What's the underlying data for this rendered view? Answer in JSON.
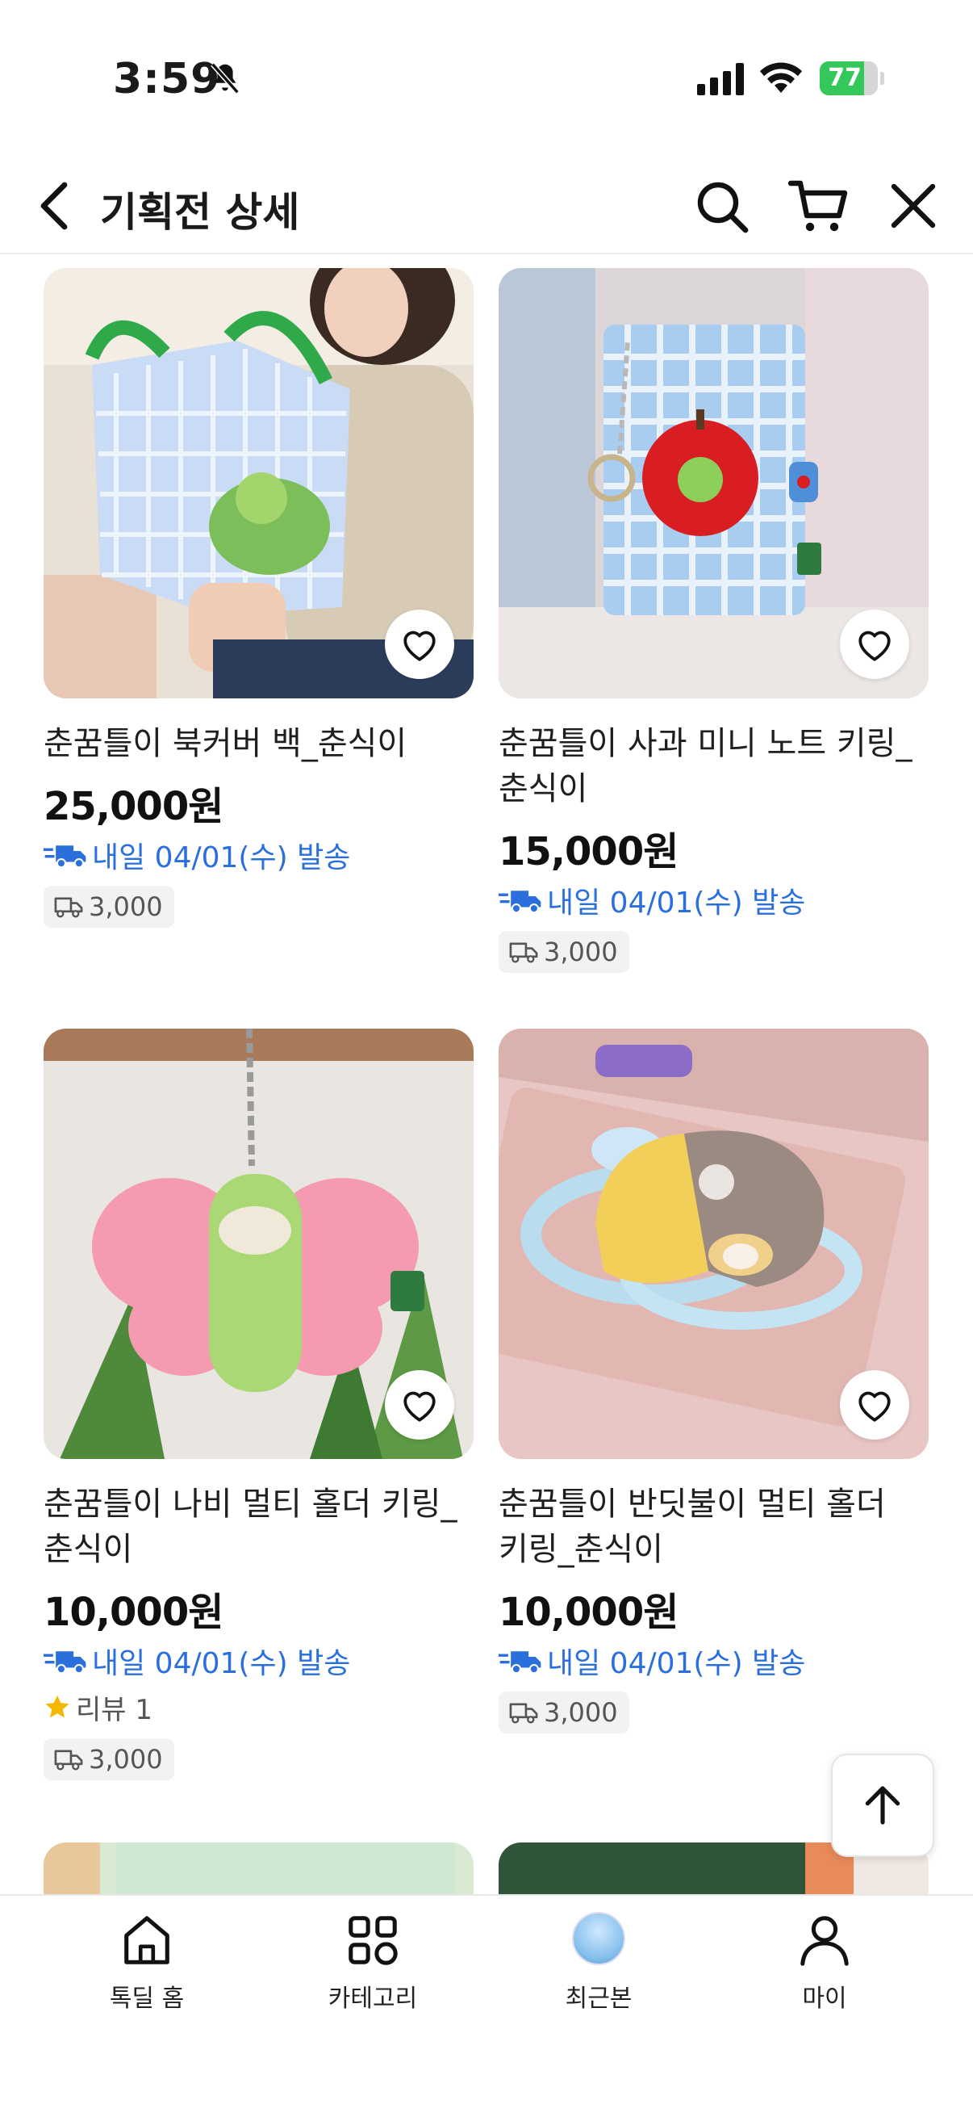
{
  "status_bar": {
    "time": "3:59",
    "battery": "77",
    "battery_level": 0.77
  },
  "header": {
    "title": "기획전 상세"
  },
  "products": [
    {
      "name": "춘꿈틀이 북커버 백_춘식이",
      "price": "25,000원",
      "shipping": "내일 04/01(수) 발송",
      "delivery_fee": "3,000"
    },
    {
      "name": "춘꿈틀이 사과 미니 노트 키링_춘식이",
      "price": "15,000원",
      "shipping": "내일 04/01(수) 발송",
      "delivery_fee": "3,000"
    },
    {
      "name": "춘꿈틀이 나비 멀티 홀더 키링_춘식이",
      "price": "10,000원",
      "shipping": "내일 04/01(수) 발송",
      "review": "리뷰 1",
      "delivery_fee": "3,000"
    },
    {
      "name": "춘꿈틀이 반딧불이 멀티 홀더 키링_춘식이",
      "price": "10,000원",
      "shipping": "내일 04/01(수) 발송",
      "delivery_fee": "3,000"
    }
  ],
  "bottom_nav": {
    "items": [
      {
        "label": "톡딜 홈",
        "icon": "home-icon"
      },
      {
        "label": "카테고리",
        "icon": "category-icon"
      },
      {
        "label": "최근본",
        "icon": "recent-thumbnail"
      },
      {
        "label": "마이",
        "icon": "person-icon"
      }
    ]
  },
  "colors": {
    "accent_blue": "#2a6fdb",
    "battery_green": "#34c759",
    "star_yellow": "#f5b800"
  }
}
